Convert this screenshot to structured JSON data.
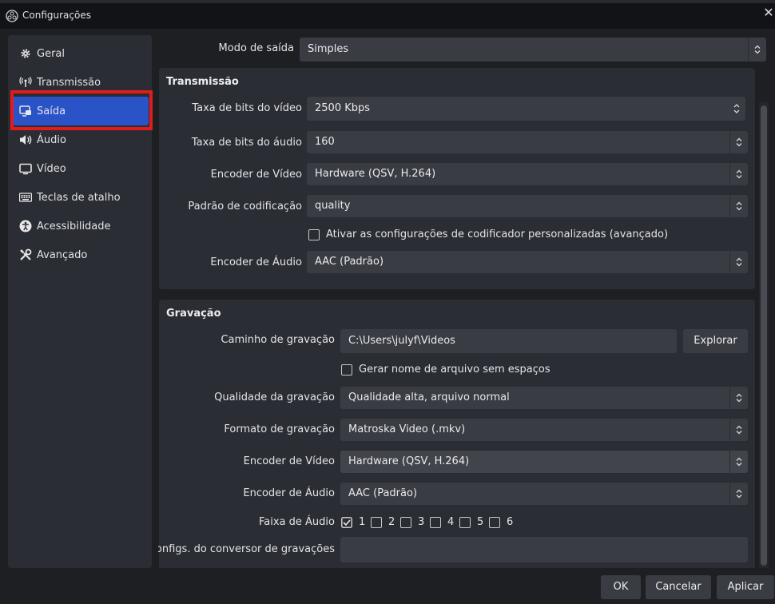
{
  "window": {
    "title": "Configurações",
    "close_icon": "close-icon"
  },
  "sidebar": {
    "items": [
      {
        "label": "Geral",
        "icon": "gear-icon"
      },
      {
        "label": "Transmissão",
        "icon": "antenna-icon"
      },
      {
        "label": "Saída",
        "icon": "output-icon",
        "active": true
      },
      {
        "label": "Áudio",
        "icon": "speaker-icon"
      },
      {
        "label": "Vídeo",
        "icon": "monitor-icon"
      },
      {
        "label": "Teclas de atalho",
        "icon": "keyboard-icon"
      },
      {
        "label": "Acessibilidade",
        "icon": "accessibility-icon"
      },
      {
        "label": "Avançado",
        "icon": "tools-icon"
      }
    ],
    "highlight_color": "#e41b1b",
    "active_color": "#2a53c8"
  },
  "output_mode": {
    "label": "Modo de saída",
    "value": "Simples"
  },
  "streaming": {
    "title": "Transmissão",
    "video_bitrate": {
      "label": "Taxa de bits do vídeo",
      "value": "2500 Kbps"
    },
    "audio_bitrate": {
      "label": "Taxa de bits do áudio",
      "value": "160"
    },
    "video_encoder": {
      "label": "Encoder de Vídeo",
      "value": "Hardware (QSV, H.264)"
    },
    "encoder_preset": {
      "label": "Padrão de codificação",
      "value": "quality"
    },
    "custom_encoder": {
      "label": "Ativar as configurações de codificador personalizadas (avançado)",
      "checked": false
    },
    "audio_encoder": {
      "label": "Encoder de Áudio",
      "value": "AAC (Padrão)"
    }
  },
  "recording": {
    "title": "Gravação",
    "path": {
      "label": "Caminho de gravação",
      "value": "C:\\Users\\julyf\\Videos",
      "browse_label": "Explorar"
    },
    "no_spaces": {
      "label": "Gerar nome de arquivo sem espaços",
      "checked": false
    },
    "quality": {
      "label": "Qualidade da gravação",
      "value": "Qualidade alta, arquivo normal"
    },
    "format": {
      "label": "Formato de gravação",
      "value": "Matroska Video (.mkv)"
    },
    "video_encoder": {
      "label": "Encoder de Vídeo",
      "value": "Hardware (QSV, H.264)"
    },
    "audio_encoder": {
      "label": "Encoder de Áudio",
      "value": "AAC (Padrão)"
    },
    "audio_track": {
      "label": "Faixa de Áudio",
      "tracks": [
        {
          "label": "1",
          "checked": true
        },
        {
          "label": "2",
          "checked": false
        },
        {
          "label": "3",
          "checked": false
        },
        {
          "label": "4",
          "checked": false
        },
        {
          "label": "5",
          "checked": false
        },
        {
          "label": "6",
          "checked": false
        }
      ]
    },
    "remux": {
      "label": "Configs. do conversor de gravações",
      "value": ""
    }
  },
  "footer": {
    "ok_label": "OK",
    "cancel_label": "Cancelar",
    "apply_label": "Aplicar"
  }
}
